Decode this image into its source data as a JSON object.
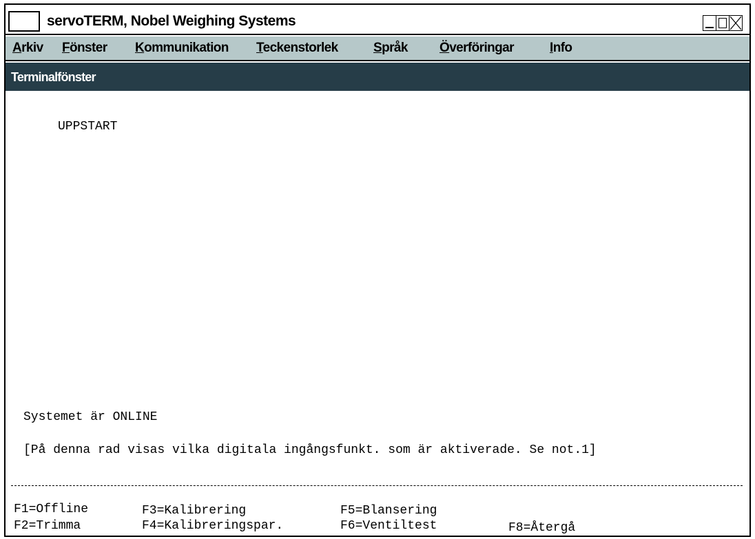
{
  "window": {
    "title": "servoTERM, Nobel Weighing Systems"
  },
  "menubar": {
    "items": [
      {
        "label": "Arkiv",
        "accel": "A",
        "rest": "rkiv"
      },
      {
        "label": "Fönster",
        "accel": "F",
        "rest": "önster"
      },
      {
        "label": "Kommunikation",
        "accel": "K",
        "rest": "ommunikation"
      },
      {
        "label": "Teckenstorlek",
        "accel": "T",
        "rest": "eckenstorlek"
      },
      {
        "label": "Språk",
        "accel": "S",
        "rest": "pråk"
      },
      {
        "label": "Överföringar",
        "accel": "Ö",
        "rest": "verföringar"
      },
      {
        "label": "Info",
        "accel": "I",
        "rest": "nfo"
      }
    ]
  },
  "panel": {
    "title": "Terminalfönster"
  },
  "terminal": {
    "heading": "UPPSTART",
    "status": "Systemet är ONLINE",
    "note": "[På denna rad visas vilka digitala ingångsfunkt. som är aktiverade. Se not.1]"
  },
  "function_keys": {
    "f1": "F1=Offline",
    "f2": "F2=Trimma",
    "f3": "F3=Kalibrering",
    "f4": "F4=Kalibreringspar.",
    "f5": "F5=Blansering",
    "f6": "F6=Ventiltest",
    "f8": "F8=Återgå"
  },
  "colors": {
    "menubar_bg": "#b6c8c9",
    "panel_header_bg": "#263d48"
  }
}
